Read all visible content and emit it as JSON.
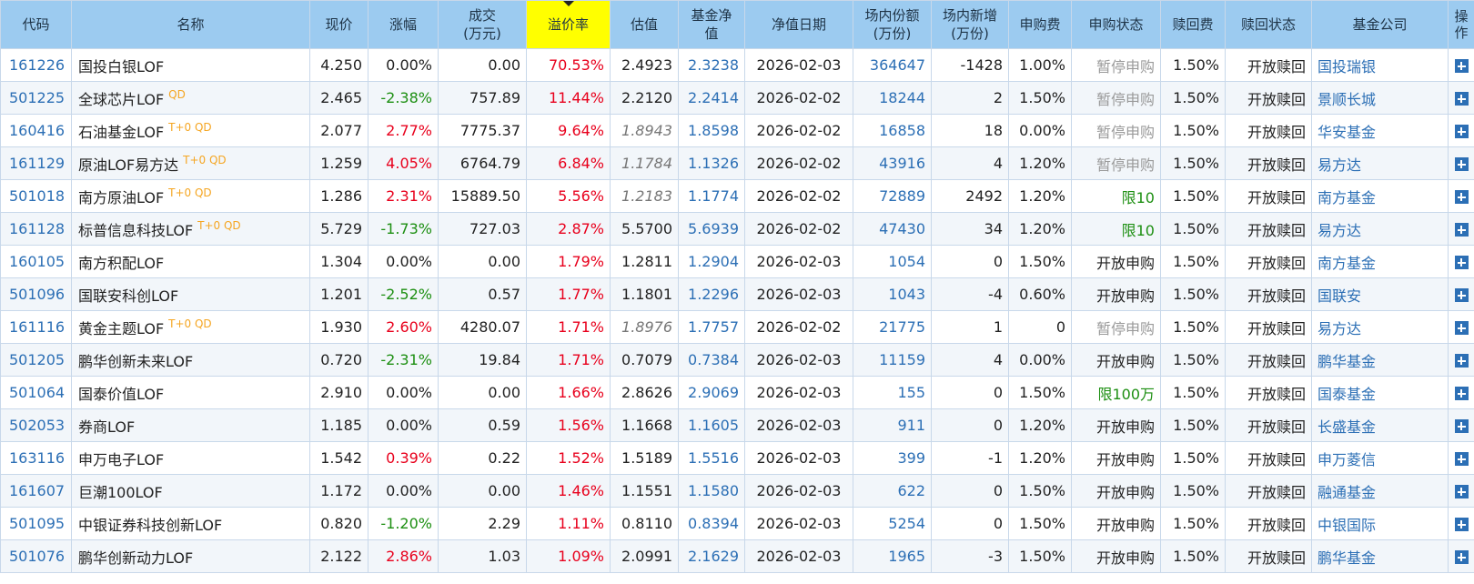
{
  "columns": {
    "code": "代码",
    "name": "名称",
    "price": "现价",
    "change": "涨幅",
    "volume_1": "成交",
    "volume_2": "(万元)",
    "premium": "溢价率",
    "estimate": "估值",
    "nav_1": "基金净",
    "nav_2": "值",
    "nav_date": "净值日期",
    "shares_1": "场内份额",
    "shares_2": "(万份)",
    "new_shares_1": "场内新增",
    "new_shares_2": "(万份)",
    "sub_fee": "申购费",
    "sub_status": "申购状态",
    "redeem_fee": "赎回费",
    "redeem_status": "赎回状态",
    "company": "基金公司",
    "op": "操作"
  },
  "colors": {
    "header_bg": "#9ccbf0",
    "sorted_header_bg": "#ffff00",
    "up": "#e8001c",
    "down": "#1d8f12",
    "link": "#2c6fb5",
    "tag": "#f5a623"
  },
  "rows": [
    {
      "code": "161226",
      "name": "国投白银LOF",
      "tag": "",
      "price": "4.250",
      "change": "0.00%",
      "dir": "zero",
      "volume": "0.00",
      "premium": "70.53%",
      "estimate": "2.4923",
      "est_italic": false,
      "nav": "2.3238",
      "nav_date": "2026-02-03",
      "shares": "364647",
      "new_shares": "-1428",
      "sub_fee": "1.00%",
      "sub_status": "暂停申购",
      "sub_class": "muted",
      "redeem_fee": "1.50%",
      "redeem_status": "开放赎回",
      "company": "国投瑞银"
    },
    {
      "code": "501225",
      "name": "全球芯片LOF",
      "tag": "QD",
      "price": "2.465",
      "change": "-2.38%",
      "dir": "down",
      "volume": "757.89",
      "premium": "11.44%",
      "estimate": "2.2120",
      "est_italic": false,
      "nav": "2.2414",
      "nav_date": "2026-02-02",
      "shares": "18244",
      "new_shares": "2",
      "sub_fee": "1.50%",
      "sub_status": "暂停申购",
      "sub_class": "muted",
      "redeem_fee": "1.50%",
      "redeem_status": "开放赎回",
      "company": "景顺长城"
    },
    {
      "code": "160416",
      "name": "石油基金LOF",
      "tag": "T+0 QD",
      "price": "2.077",
      "change": "2.77%",
      "dir": "up",
      "volume": "7775.37",
      "premium": "9.64%",
      "estimate": "1.8943",
      "est_italic": true,
      "nav": "1.8598",
      "nav_date": "2026-02-02",
      "shares": "16858",
      "new_shares": "18",
      "sub_fee": "0.00%",
      "sub_status": "暂停申购",
      "sub_class": "muted",
      "redeem_fee": "1.50%",
      "redeem_status": "开放赎回",
      "company": "华安基金"
    },
    {
      "code": "161129",
      "name": "原油LOF易方达",
      "tag": "T+0 QD",
      "price": "1.259",
      "change": "4.05%",
      "dir": "up",
      "volume": "6764.79",
      "premium": "6.84%",
      "estimate": "1.1784",
      "est_italic": true,
      "nav": "1.1326",
      "nav_date": "2026-02-02",
      "shares": "43916",
      "new_shares": "4",
      "sub_fee": "1.20%",
      "sub_status": "暂停申购",
      "sub_class": "muted",
      "redeem_fee": "1.50%",
      "redeem_status": "开放赎回",
      "company": "易方达"
    },
    {
      "code": "501018",
      "name": "南方原油LOF",
      "tag": "T+0 QD",
      "price": "1.286",
      "change": "2.31%",
      "dir": "up",
      "volume": "15889.50",
      "premium": "5.56%",
      "estimate": "1.2183",
      "est_italic": true,
      "nav": "1.1774",
      "nav_date": "2026-02-02",
      "shares": "72889",
      "new_shares": "2492",
      "sub_fee": "1.20%",
      "sub_status": "限10",
      "sub_class": "green",
      "redeem_fee": "1.50%",
      "redeem_status": "开放赎回",
      "company": "南方基金"
    },
    {
      "code": "161128",
      "name": "标普信息科技LOF",
      "tag": "T+0 QD",
      "price": "5.729",
      "change": "-1.73%",
      "dir": "down",
      "volume": "727.03",
      "premium": "2.87%",
      "estimate": "5.5700",
      "est_italic": false,
      "nav": "5.6939",
      "nav_date": "2026-02-02",
      "shares": "47430",
      "new_shares": "34",
      "sub_fee": "1.20%",
      "sub_status": "限10",
      "sub_class": "green",
      "redeem_fee": "1.50%",
      "redeem_status": "开放赎回",
      "company": "易方达"
    },
    {
      "code": "160105",
      "name": "南方积配LOF",
      "tag": "",
      "price": "1.304",
      "change": "0.00%",
      "dir": "zero",
      "volume": "0.00",
      "premium": "1.79%",
      "estimate": "1.2811",
      "est_italic": false,
      "nav": "1.2904",
      "nav_date": "2026-02-03",
      "shares": "1054",
      "new_shares": "0",
      "sub_fee": "1.50%",
      "sub_status": "开放申购",
      "sub_class": "",
      "redeem_fee": "1.50%",
      "redeem_status": "开放赎回",
      "company": "南方基金"
    },
    {
      "code": "501096",
      "name": "国联安科创LOF",
      "tag": "",
      "price": "1.201",
      "change": "-2.52%",
      "dir": "down",
      "volume": "0.57",
      "premium": "1.77%",
      "estimate": "1.1801",
      "est_italic": false,
      "nav": "1.2296",
      "nav_date": "2026-02-03",
      "shares": "1043",
      "new_shares": "-4",
      "sub_fee": "0.60%",
      "sub_status": "开放申购",
      "sub_class": "",
      "redeem_fee": "1.50%",
      "redeem_status": "开放赎回",
      "company": "国联安"
    },
    {
      "code": "161116",
      "name": "黄金主题LOF",
      "tag": "T+0 QD",
      "price": "1.930",
      "change": "2.60%",
      "dir": "up",
      "volume": "4280.07",
      "premium": "1.71%",
      "estimate": "1.8976",
      "est_italic": true,
      "nav": "1.7757",
      "nav_date": "2026-02-02",
      "shares": "21775",
      "new_shares": "1",
      "sub_fee": "0",
      "sub_status": "暂停申购",
      "sub_class": "muted",
      "redeem_fee": "1.50%",
      "redeem_status": "开放赎回",
      "company": "易方达"
    },
    {
      "code": "501205",
      "name": "鹏华创新未来LOF",
      "tag": "",
      "price": "0.720",
      "change": "-2.31%",
      "dir": "down",
      "volume": "19.84",
      "premium": "1.71%",
      "estimate": "0.7079",
      "est_italic": false,
      "nav": "0.7384",
      "nav_date": "2026-02-03",
      "shares": "11159",
      "new_shares": "4",
      "sub_fee": "0.00%",
      "sub_status": "开放申购",
      "sub_class": "",
      "redeem_fee": "1.50%",
      "redeem_status": "开放赎回",
      "company": "鹏华基金"
    },
    {
      "code": "501064",
      "name": "国泰价值LOF",
      "tag": "",
      "price": "2.910",
      "change": "0.00%",
      "dir": "zero",
      "volume": "0.00",
      "premium": "1.66%",
      "estimate": "2.8626",
      "est_italic": false,
      "nav": "2.9069",
      "nav_date": "2026-02-03",
      "shares": "155",
      "new_shares": "0",
      "sub_fee": "1.50%",
      "sub_status": "限100万",
      "sub_class": "green",
      "redeem_fee": "1.50%",
      "redeem_status": "开放赎回",
      "company": "国泰基金"
    },
    {
      "code": "502053",
      "name": "券商LOF",
      "tag": "",
      "price": "1.185",
      "change": "0.00%",
      "dir": "zero",
      "volume": "0.59",
      "premium": "1.56%",
      "estimate": "1.1668",
      "est_italic": false,
      "nav": "1.1605",
      "nav_date": "2026-02-03",
      "shares": "911",
      "new_shares": "0",
      "sub_fee": "1.20%",
      "sub_status": "开放申购",
      "sub_class": "",
      "redeem_fee": "1.50%",
      "redeem_status": "开放赎回",
      "company": "长盛基金"
    },
    {
      "code": "163116",
      "name": "申万电子LOF",
      "tag": "",
      "price": "1.542",
      "change": "0.39%",
      "dir": "up",
      "volume": "0.22",
      "premium": "1.52%",
      "estimate": "1.5189",
      "est_italic": false,
      "nav": "1.5516",
      "nav_date": "2026-02-03",
      "shares": "399",
      "new_shares": "-1",
      "sub_fee": "1.20%",
      "sub_status": "开放申购",
      "sub_class": "",
      "redeem_fee": "1.50%",
      "redeem_status": "开放赎回",
      "company": "申万菱信"
    },
    {
      "code": "161607",
      "name": "巨潮100LOF",
      "tag": "",
      "price": "1.172",
      "change": "0.00%",
      "dir": "zero",
      "volume": "0.00",
      "premium": "1.46%",
      "estimate": "1.1551",
      "est_italic": false,
      "nav": "1.1580",
      "nav_date": "2026-02-03",
      "shares": "622",
      "new_shares": "0",
      "sub_fee": "1.50%",
      "sub_status": "开放申购",
      "sub_class": "",
      "redeem_fee": "1.50%",
      "redeem_status": "开放赎回",
      "company": "融通基金"
    },
    {
      "code": "501095",
      "name": "中银证券科技创新LOF",
      "tag": "",
      "price": "0.820",
      "change": "-1.20%",
      "dir": "down",
      "volume": "2.29",
      "premium": "1.11%",
      "estimate": "0.8110",
      "est_italic": false,
      "nav": "0.8394",
      "nav_date": "2026-02-03",
      "shares": "5254",
      "new_shares": "0",
      "sub_fee": "1.50%",
      "sub_status": "开放申购",
      "sub_class": "",
      "redeem_fee": "1.50%",
      "redeem_status": "开放赎回",
      "company": "中银国际"
    },
    {
      "code": "501076",
      "name": "鹏华创新动力LOF",
      "tag": "",
      "price": "2.122",
      "change": "2.86%",
      "dir": "up",
      "volume": "1.03",
      "premium": "1.09%",
      "estimate": "2.0991",
      "est_italic": false,
      "nav": "2.1629",
      "nav_date": "2026-02-03",
      "shares": "1965",
      "new_shares": "-3",
      "sub_fee": "1.50%",
      "sub_status": "开放申购",
      "sub_class": "",
      "redeem_fee": "1.50%",
      "redeem_status": "开放赎回",
      "company": "鹏华基金"
    }
  ]
}
